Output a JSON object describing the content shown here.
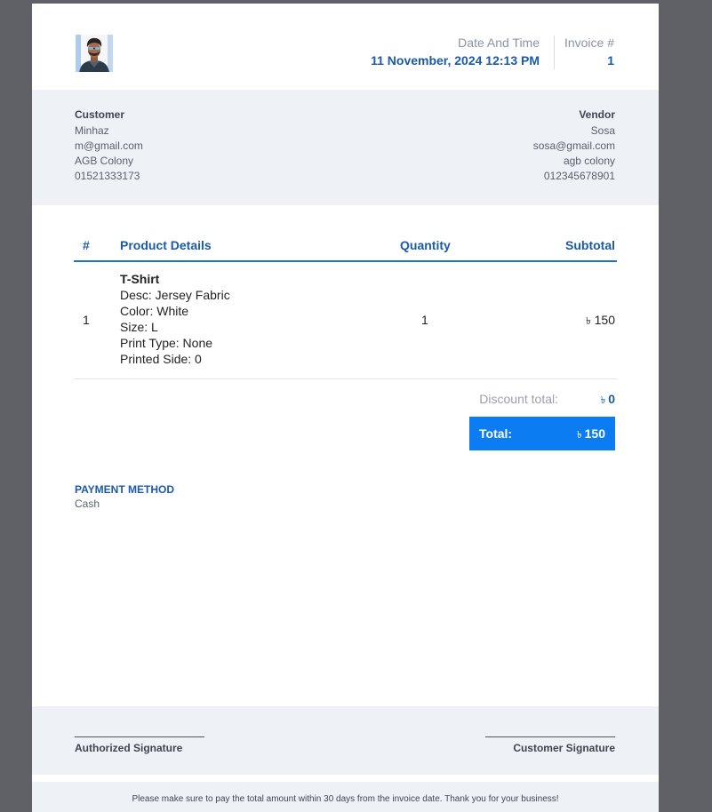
{
  "header": {
    "date_label": "Date And Time",
    "date_value": "11 November, 2024 12:13 PM",
    "invoice_label": "Invoice #",
    "invoice_value": "1"
  },
  "customer": {
    "title": "Customer",
    "name": "Minhaz",
    "email": "m@gmail.com",
    "address": "AGB Colony",
    "phone": "01521333173"
  },
  "vendor": {
    "title": "Vendor",
    "name": "Sosa",
    "email": "sosa@gmail.com",
    "address": "agb colony",
    "phone": "012345678901"
  },
  "table": {
    "headers": {
      "num": "#",
      "product": "Product Details",
      "quantity": "Quantity",
      "subtotal": "Subtotal"
    },
    "rows": [
      {
        "num": "1",
        "name": "T-Shirt",
        "desc": "Desc: Jersey Fabric",
        "color": "Color: White",
        "size": "Size: L",
        "print_type": "Print Type: None",
        "printed_side": "Printed Side: 0",
        "quantity": "1",
        "currency": "৳",
        "subtotal": "150"
      }
    ]
  },
  "summary": {
    "discount_label": "Discount total:",
    "currency": "৳",
    "discount_value": "0",
    "total_label": "Total:",
    "total_value": "150"
  },
  "payment": {
    "title": "PAYMENT METHOD",
    "value": "Cash"
  },
  "signatures": {
    "left": "Authorized Signature",
    "right": "Customer Signature"
  },
  "footer": {
    "note": "Please make sure to pay the total amount within 30 days from the invoice date. Thank you for your business!"
  },
  "colors": {
    "accent": "#1a5aa8",
    "total_bg": "#0b7cf2",
    "band_bg": "#eef2f7",
    "backdrop": "#5f6166"
  },
  "icons": {
    "avatar": "customer-avatar-photo"
  }
}
